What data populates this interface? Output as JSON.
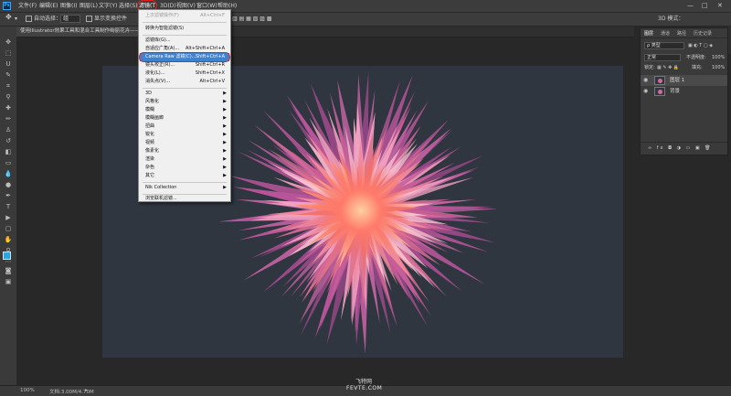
{
  "menubar": {
    "items": [
      "文件(F)",
      "编辑(E)",
      "图像(I)",
      "图层(L)",
      "文字(Y)",
      "选择(S)",
      "滤镜(T)",
      "3D(D)",
      "视图(V)",
      "窗口(W)",
      "帮助(H)"
    ],
    "logo": "Ps",
    "window": {
      "minimize": "—",
      "restore": "□",
      "close": "✕"
    }
  },
  "options": {
    "auto_select": "自动选择：",
    "group_value": "组",
    "show_transform": "显示变换控件",
    "mode_3d": "3D 模式："
  },
  "doc_tab": "使用Illustrator效果工具和混合工具制作绚丽花卉——AI...",
  "filter_menu": {
    "last_filter": "上次滤镜操作(F)",
    "last_filter_sc": "Alt+Ctrl+F",
    "smart": "转换为智能滤镜(S)",
    "gallery": "滤镜库(G)...",
    "wide_angle": "自适应广角(A)...",
    "wide_angle_sc": "Alt+Shift+Ctrl+A",
    "camera_raw": "Camera Raw 滤镜(C)...",
    "camera_raw_sc": "Shift+Ctrl+A",
    "lens": "镜头校正(R)...",
    "lens_sc": "Shift+Ctrl+R",
    "liquify": "液化(L)...",
    "liquify_sc": "Shift+Ctrl+X",
    "vanishing": "消失点(V)...",
    "vanishing_sc": "Alt+Ctrl+V",
    "submenus": [
      "3D",
      "风格化",
      "模糊",
      "模糊画廊",
      "扭曲",
      "锐化",
      "视频",
      "像素化",
      "渲染",
      "杂色",
      "其它"
    ],
    "nik": "Nik Collection",
    "browse": "浏览联机滤镜..."
  },
  "layers_panel": {
    "tabs": [
      "图层",
      "通道",
      "路径",
      "历史记录"
    ],
    "kind": "ρ 类型",
    "blend": "正常",
    "opacity_label": "不透明度:",
    "opacity": "100%",
    "lock_label": "锁定:",
    "fill_label": "填充:",
    "fill": "100%",
    "layers": [
      {
        "name": "图层 1",
        "visible": "👁"
      },
      {
        "name": "背景",
        "visible": "👁"
      }
    ],
    "footer_icons": "∞  fx  ◘  ◑  ▭  ▣  🗑"
  },
  "status": {
    "zoom": "100%",
    "doc": "文档:3.00M/4.70M"
  },
  "watermark": {
    "line1": "飞特网",
    "line2": "FEVTE.COM"
  },
  "colors": {
    "accent": "#3e82d0",
    "canvas": "#2f3640",
    "flower_core": "#f06a6a",
    "flower_outer": "#b8559a"
  }
}
